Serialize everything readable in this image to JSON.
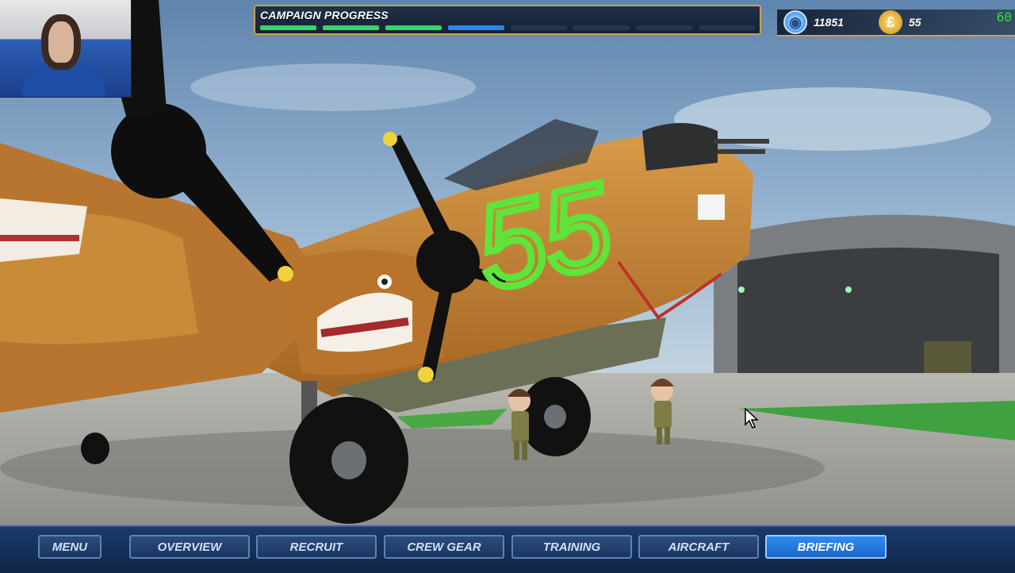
{
  "hud": {
    "campaign_title": "CAMPAIGN PROGRESS",
    "progress_segments": [
      "done",
      "done",
      "done",
      "current",
      "empty",
      "empty",
      "empty",
      "empty"
    ],
    "reputation_value": "11851",
    "money_value": "55",
    "money_symbol": "£",
    "fps": "60"
  },
  "aircraft": {
    "nose_art_number": "55"
  },
  "nav": {
    "menu": "MENU",
    "overview": "OVERVIEW",
    "recruit": "RECRUIT",
    "crew_gear": "CREW GEAR",
    "training": "TRAINING",
    "aircraft": "AIRCRAFT",
    "briefing": "BRIEFING",
    "active": "briefing"
  },
  "colors": {
    "accent_gold": "#c9a24a",
    "progress_done": "#3dd06a",
    "progress_current": "#2f86e6",
    "active_button": "#2f8cf1",
    "aircraft_body": "#c8852f",
    "nose_art": "#5fe43a"
  }
}
